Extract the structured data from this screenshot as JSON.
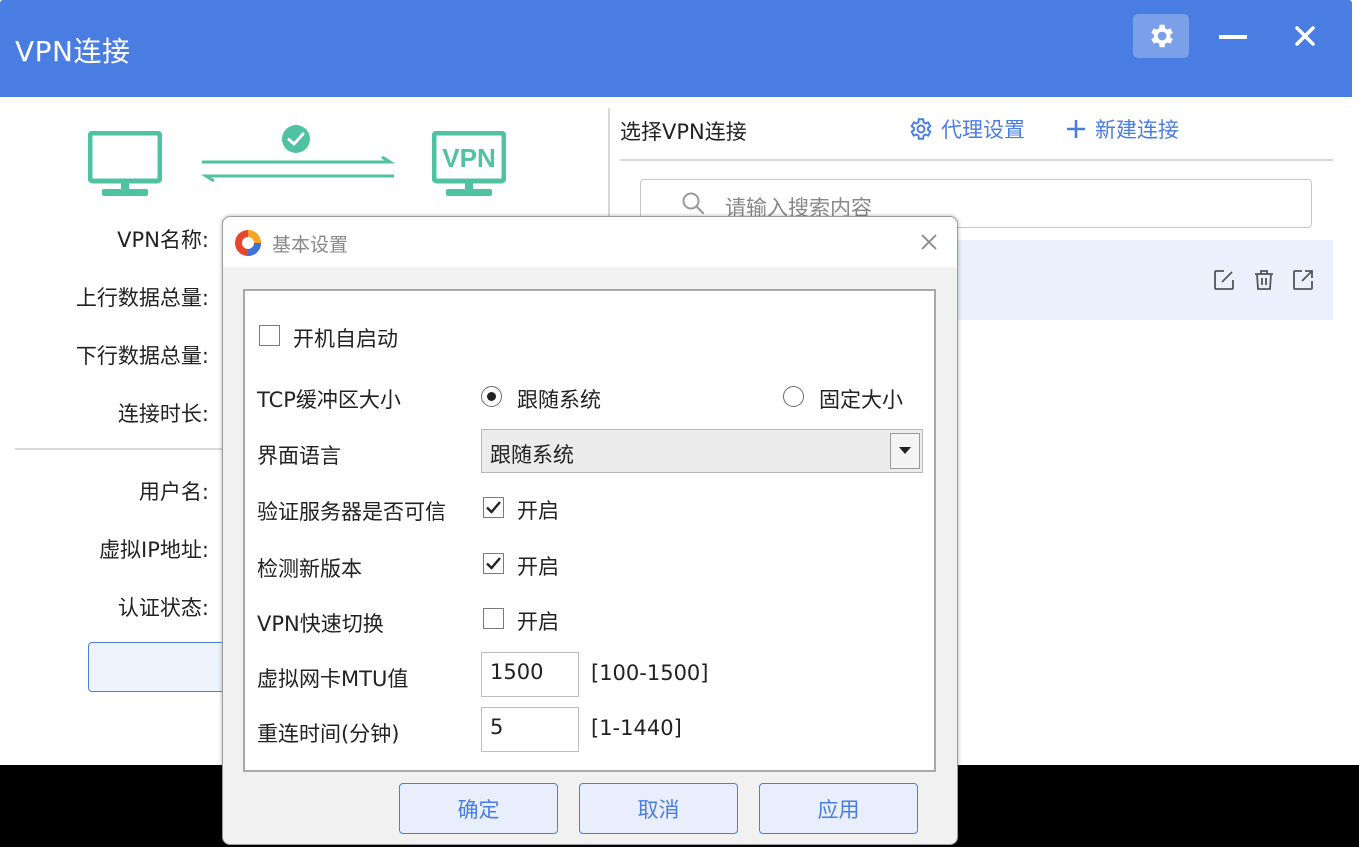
{
  "window": {
    "title": "VPN连接",
    "controls": [
      "gear-icon",
      "minimize-icon",
      "close-icon"
    ]
  },
  "left_panel": {
    "illustration": {
      "left_icon": "monitor-icon",
      "center_icon": "check-circle-icon",
      "right_icon_text": "VPN"
    },
    "fields": [
      {
        "label": "VPN名称:"
      },
      {
        "label": "上行数据总量:"
      },
      {
        "label": "下行数据总量:"
      },
      {
        "label": "连接时长:"
      },
      {
        "label": "用户名:"
      },
      {
        "label": "虚拟IP地址:"
      },
      {
        "label": "认证状态:"
      }
    ]
  },
  "right_panel": {
    "title": "选择VPN连接",
    "proxy_settings": "代理设置",
    "new_connection": "新建连接",
    "search_placeholder": "请输入搜索内容",
    "row_actions": [
      "edit-icon",
      "trash-icon",
      "external-link-icon"
    ]
  },
  "dialog": {
    "title": "基本设置",
    "autostart_label": "开机自启动",
    "autostart_checked": false,
    "tcp_buffer_label": "TCP缓冲区大小",
    "tcp_buffer_options": [
      "跟随系统",
      "固定大小"
    ],
    "tcp_buffer_selected": "跟随系统",
    "language_label": "界面语言",
    "language_value": "跟随系统",
    "verify_server_label": "验证服务器是否可信",
    "verify_server_text": "开启",
    "verify_server_checked": true,
    "check_update_label": "检测新版本",
    "check_update_text": "开启",
    "check_update_checked": true,
    "fast_switch_label": "VPN快速切换",
    "fast_switch_text": "开启",
    "fast_switch_checked": false,
    "mtu_label": "虚拟网卡MTU值",
    "mtu_value": "1500",
    "mtu_range": "[100-1500]",
    "reconnect_label": "重连时间(分钟)",
    "reconnect_value": "5",
    "reconnect_range": "[1-1440]",
    "buttons": {
      "ok": "确定",
      "cancel": "取消",
      "apply": "应用"
    }
  },
  "colors": {
    "accent": "#4a7de2",
    "illustration": "#4fc3a1",
    "selected_row": "#ebf0fc"
  }
}
